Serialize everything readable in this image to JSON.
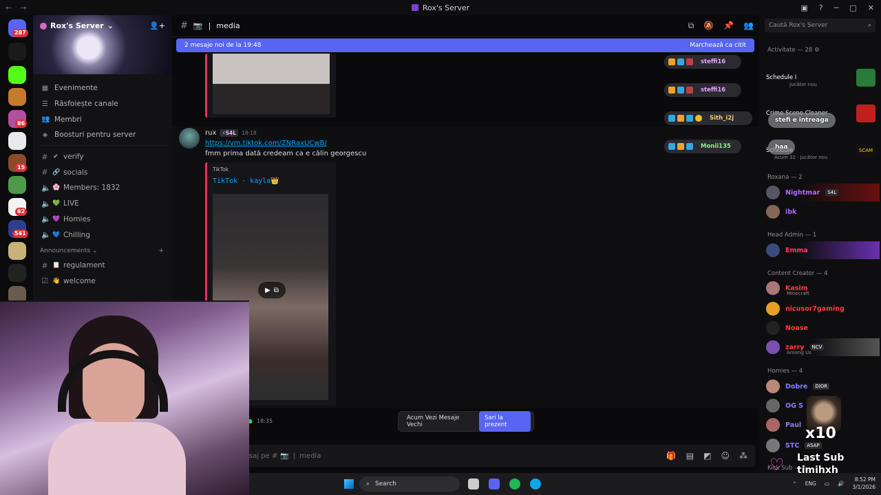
{
  "window": {
    "title": "Rox's Server"
  },
  "rail": {
    "badges": [
      "287",
      "86",
      "15",
      "62",
      "541"
    ]
  },
  "server": {
    "name": "Rox's Server",
    "menu": [
      {
        "label": "Evenimente",
        "icon": "calendar-icon"
      },
      {
        "label": "Răsfoiește canale",
        "icon": "browse-icon"
      },
      {
        "label": "Membri",
        "icon": "members-icon"
      },
      {
        "label": "Boosturi pentru server",
        "icon": "boost-icon"
      }
    ],
    "channels": [
      {
        "label": "verify",
        "emoji": "✔",
        "kind": "text"
      },
      {
        "label": "socials",
        "emoji": "🔗",
        "kind": "text"
      },
      {
        "label": "Members: 1832",
        "emoji": "🌸",
        "kind": "voice"
      },
      {
        "label": "LIVE",
        "emoji": "💚",
        "kind": "voice"
      },
      {
        "label": "Homies",
        "emoji": "💜",
        "kind": "voice"
      },
      {
        "label": "Chilling",
        "emoji": "💙",
        "kind": "voice"
      }
    ],
    "category": "Announcements",
    "announcements": [
      {
        "label": "regulament",
        "emoji": "📋"
      },
      {
        "label": "welcome",
        "emoji": "👋"
      }
    ]
  },
  "channel_header": {
    "name": "media",
    "prefix": "📷"
  },
  "new_messages": {
    "text": "2 mesaje noi de la 19:48",
    "mark_read": "Marchează ca citit"
  },
  "message": {
    "author": "rux",
    "tag": "S4L",
    "time": "18:18",
    "link": "https://vm.tiktok.com/ZNRaxUCwB/",
    "text": "fmm prima dată credeam ca e călin georgescu",
    "embed": {
      "provider": "TikTok",
      "title": "TikTok · kayla👑"
    }
  },
  "reactions": [
    {
      "name": "steffi16"
    },
    {
      "name": "steffi16"
    },
    {
      "name": "Sith_i2j"
    },
    {
      "name": "Monii135"
    }
  ],
  "jump_bar": {
    "text": "Acum Vezi Mesaje Vechi",
    "button": "Sari la prezent"
  },
  "mini_message": {
    "time": "18:35"
  },
  "composer": {
    "placeholder": "saj pe #",
    "channel": "media"
  },
  "member_list": {
    "search": "Caută Rox's Server",
    "activity_header": "Activitate — 28",
    "activity": [
      {
        "name": "Schedule I",
        "sub": "jucător nou"
      },
      {
        "name": "Crime Scene Cleaner",
        "sub": ""
      },
      {
        "name": "Schedule",
        "sub": "Acum 32 · jucător nou"
      }
    ],
    "sections": [
      {
        "title": "Roxana — 2",
        "members": [
          {
            "name": "Nightmar",
            "tag": "S4L",
            "color": "#b06cf0"
          },
          {
            "name": "ibk",
            "tag": "",
            "color": "#b06cf0"
          }
        ]
      },
      {
        "title": "Head Admin — 1",
        "members": [
          {
            "name": "Emma",
            "tag": "",
            "color": "#ff3d6e"
          }
        ]
      },
      {
        "title": "Content Creator — 4",
        "members": [
          {
            "name": "Kasim",
            "tag": "",
            "sub": "Minecraft",
            "color": "#ff3d3d"
          },
          {
            "name": "nicusor7gaming",
            "tag": "",
            "color": "#ff3d3d"
          },
          {
            "name": "Noase",
            "tag": "",
            "color": "#ff3d3d"
          },
          {
            "name": "zarry",
            "tag": "NCV",
            "sub": "Among Us",
            "color": "#ff3d3d"
          }
        ]
      },
      {
        "title": "Homies — 4",
        "members": [
          {
            "name": "Dobre",
            "tag": "DIOR",
            "color": "#8b7cff"
          },
          {
            "name": "OG S",
            "tag": "",
            "color": "#8b7cff"
          },
          {
            "name": "Paul",
            "tag": "",
            "color": "#8b7cff"
          },
          {
            "name": "STC",
            "tag": "ASAP",
            "color": "#8b7cff"
          }
        ]
      }
    ],
    "kick_sub": "Kick Sub — 8"
  },
  "floating": {
    "stefi": "stefi e intreaga",
    "haa": "haa"
  },
  "sub_alert": {
    "count": "x10",
    "label": "Last Sub",
    "user": "timihxh"
  },
  "taskbar": {
    "search": "Search",
    "lang": "ENG",
    "time": "8:52 PM",
    "date": "3/1/2026"
  }
}
